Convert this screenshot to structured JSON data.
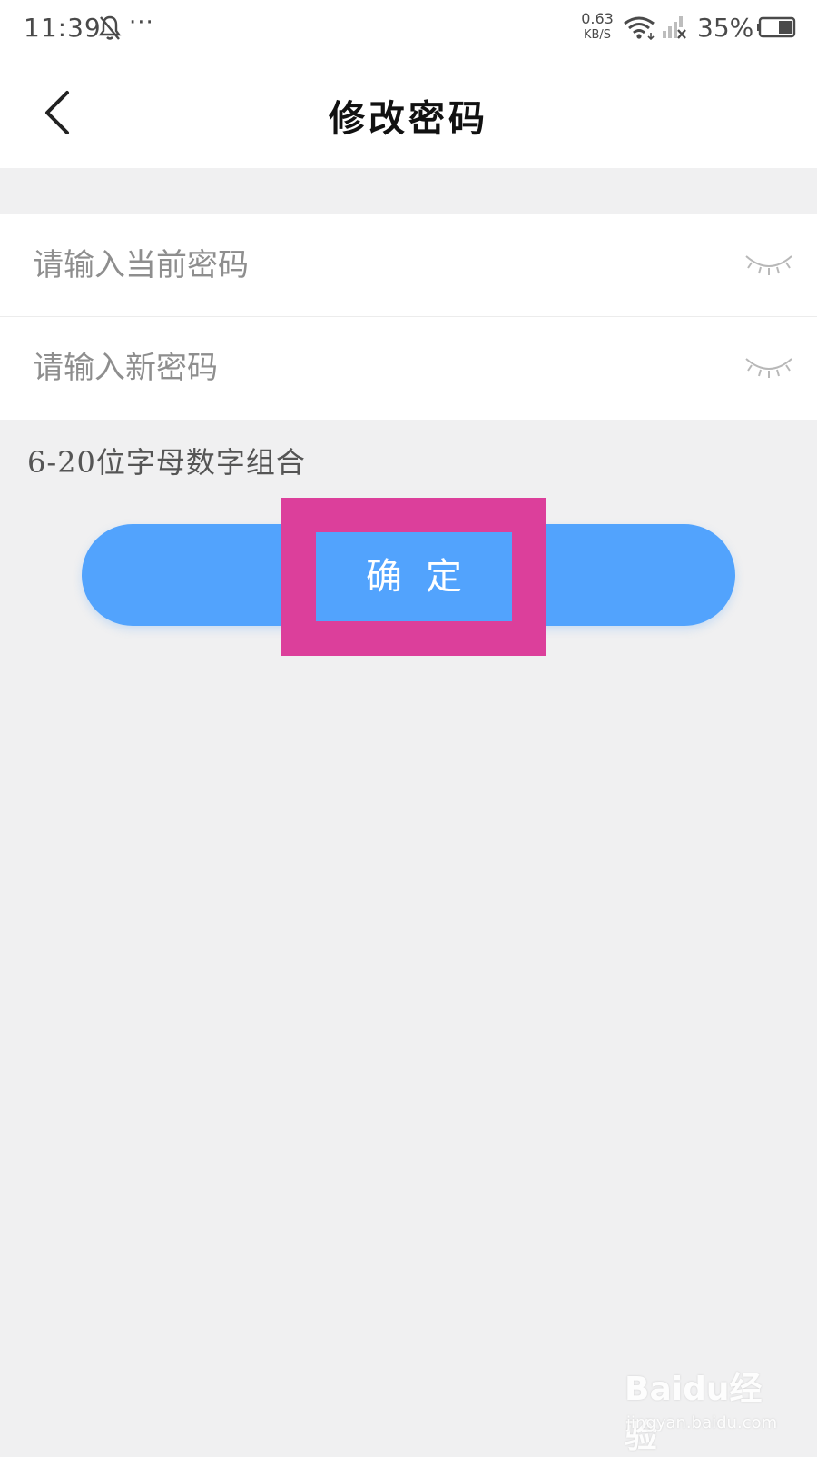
{
  "status_bar": {
    "time": "11:39",
    "more": "···",
    "net_speed_value": "0.63",
    "net_speed_unit": "KB/S",
    "battery_percent": "35%",
    "icons": [
      "bell-off-icon",
      "wifi-icon",
      "signal-icon",
      "battery-icon"
    ]
  },
  "nav": {
    "back_icon": "chevron-left-icon",
    "title": "修改密码"
  },
  "form": {
    "current_password": {
      "placeholder": "请输入当前密码",
      "value": "",
      "toggle_icon": "eye-closed-icon"
    },
    "new_password": {
      "placeholder": "请输入新密码",
      "value": "",
      "toggle_icon": "eye-closed-icon"
    },
    "hint": "6-20位字母数字组合"
  },
  "confirm_button": {
    "label": "确定"
  },
  "watermark": {
    "logo": "Baidu经验",
    "url": "jingyan.baidu.com"
  },
  "colors": {
    "accent": "#52a3fd",
    "highlight": "#dc3f9b",
    "background": "#f0f0f1"
  }
}
